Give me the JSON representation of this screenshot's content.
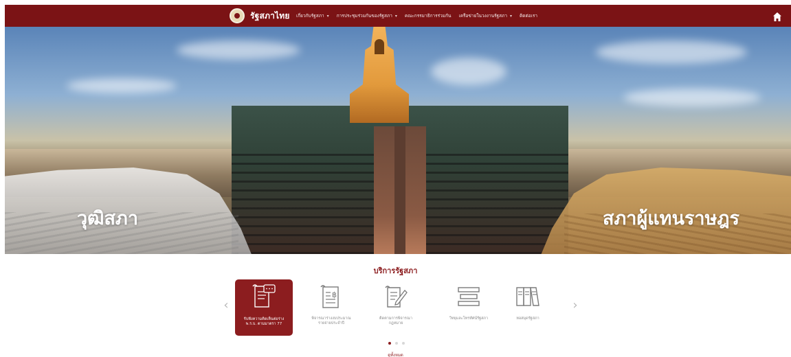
{
  "header": {
    "brand_name": "รัฐสภาไทย",
    "nav": [
      {
        "label": "เกี่ยวกับรัฐสภา",
        "has_caret": true
      },
      {
        "label": "การประชุมร่วมกันของรัฐสภา",
        "has_caret": true
      },
      {
        "label": "คณะกรรมาธิการร่วมกัน",
        "has_caret": false
      },
      {
        "label": "เครือข่ายในวงงานรัฐสภา",
        "has_caret": true
      },
      {
        "label": "ติดต่อเรา",
        "has_caret": false
      }
    ],
    "caret_glyph": "▾",
    "home_icon": "home-icon"
  },
  "hero": {
    "left_chamber_label": "วุฒิสภา",
    "right_chamber_label": "สภาผู้แทนราษฎร"
  },
  "services": {
    "title": "บริการรัฐสภา",
    "prev_glyph": "‹",
    "next_glyph": "›",
    "items": [
      {
        "label_1": "รับฟังความคิดเห็นต่อร่าง",
        "label_2": "พ.ร.บ. ตามมาตรา 77",
        "icon": "document-comment-icon",
        "active": true
      },
      {
        "label_1": "พิจารณาร่างงบประมาณ",
        "label_2": "รายจ่ายประจำปี",
        "icon": "budget-document-icon",
        "active": false
      },
      {
        "label_1": "ติดตามการพิจารณา",
        "label_2": "กฎหมาย",
        "icon": "law-tracking-icon",
        "active": false
      },
      {
        "label_1": "วิทยุและโทรทัศน์รัฐสภา",
        "label_2": "",
        "icon": "tv-radio-icon",
        "active": false
      },
      {
        "label_1": "หอสมุดรัฐสภา",
        "label_2": "",
        "icon": "library-books-icon",
        "active": false
      }
    ],
    "page_indicator": {
      "current": 1,
      "total": 3
    },
    "see_all": "ดูทั้งหมด"
  },
  "colors": {
    "brand": "#7b1315",
    "accent": "#8c1d1f",
    "muted": "#8a8a8a"
  }
}
